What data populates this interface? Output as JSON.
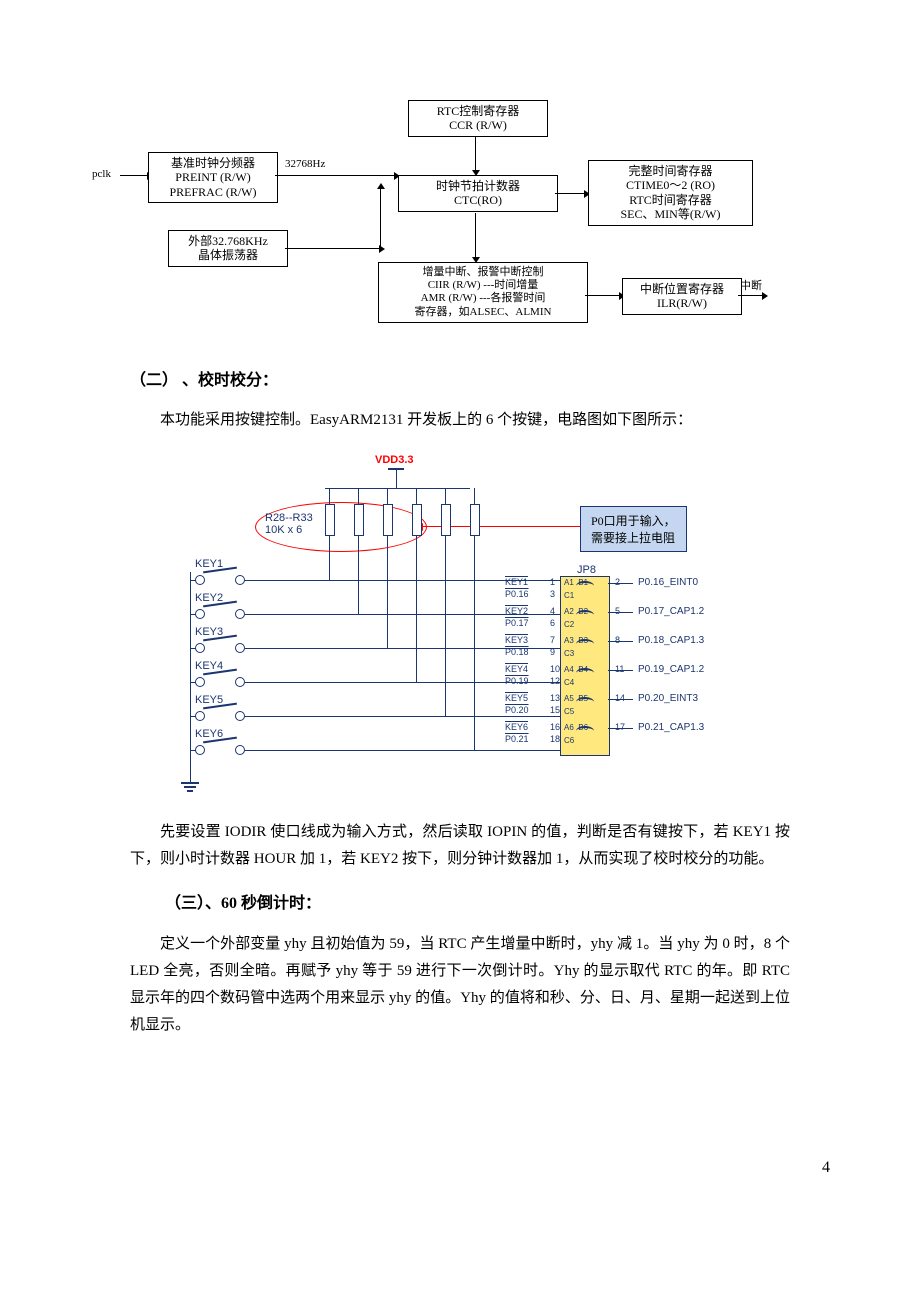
{
  "diagram1": {
    "pclk": "pclk",
    "box1": "基准时钟分频器\nPREINT (R/W)\nPREFRAC (R/W)",
    "freq": "32768Hz",
    "box2": "RTC控制寄存器\nCCR (R/W)",
    "box3": "时钟节拍计数器\nCTC(RO)",
    "box4": "完整时间寄存器\nCTIME0～2 (RO)\nRTC时间寄存器\nSEC、MIN等(R/W)",
    "box5": "外部32.768KHz\n晶体振荡器",
    "box6": "增量中断、报警中断控制\nCIIR (R/W) ---时间增量\nAMR (R/W) ---各报警时间\n寄存器，如ALSEC、ALMIN",
    "box7": "中断位置寄存器\nILR(R/W)",
    "int_out": "中断"
  },
  "section2": {
    "title": "（二） 、校时校分：",
    "para": "本功能采用按键控制。EasyARM2131 开发板上的 6 个按键，电路图如下图所示："
  },
  "diagram2": {
    "vdd": "VDD3.3",
    "res_label": "R28--R33\n10K x 6",
    "callout": "P0口用于输入，\n需要接上拉电阻",
    "keys": [
      "KEY1",
      "KEY2",
      "KEY3",
      "KEY4",
      "KEY5",
      "KEY6"
    ],
    "jp8": "JP8",
    "jp_rows": [
      {
        "kl": "KEY1",
        "l": "1",
        "r": "2",
        "sig": "A1  B1",
        "c": "",
        "port": "P0.16_EINT0",
        "p": "P0.16",
        "pl": "3",
        "cc": "C1"
      },
      {
        "kl": "KEY2",
        "l": "4",
        "r": "5",
        "sig": "A2  B2",
        "c": "",
        "port": "P0.17_CAP1.2",
        "p": "P0.17",
        "pl": "6",
        "cc": "C2"
      },
      {
        "kl": "KEY3",
        "l": "7",
        "r": "8",
        "sig": "A3  B3",
        "c": "",
        "port": "P0.18_CAP1.3",
        "p": "P0.18",
        "pl": "9",
        "cc": "C3"
      },
      {
        "kl": "KEY4",
        "l": "10",
        "r": "11",
        "sig": "A4  B4",
        "c": "",
        "port": "P0.19_CAP1.2",
        "p": "P0.19",
        "pl": "12",
        "cc": "C4"
      },
      {
        "kl": "KEY5",
        "l": "13",
        "r": "14",
        "sig": "A5  B5",
        "c": "",
        "port": "P0.20_EINT3",
        "p": "P0.20",
        "pl": "15",
        "cc": "C5"
      },
      {
        "kl": "KEY6",
        "l": "16",
        "r": "17",
        "sig": "A6  B6",
        "c": "",
        "port": "P0.21_CAP1.3",
        "p": "P0.21",
        "pl": "18",
        "cc": "C6"
      }
    ]
  },
  "section2b": {
    "para": "先要设置 IODIR 使口线成为输入方式，然后读取 IOPIN 的值，判断是否有键按下，若 KEY1 按下，则小时计数器 HOUR 加 1，若 KEY2 按下，则分钟计数器加 1，从而实现了校时校分的功能。"
  },
  "section3": {
    "title": "（三）、60 秒倒计时：",
    "para": "定义一个外部变量 yhy 且初始值为 59，当 RTC 产生增量中断时，yhy 减 1。当 yhy 为 0 时，8 个 LED 全亮，否则全暗。再赋予 yhy 等于 59 进行下一次倒计时。Yhy 的显示取代 RTC 的年。即 RTC 显示年的四个数码管中选两个用来显示 yhy 的值。Yhy 的值将和秒、分、日、月、星期一起送到上位机显示。"
  },
  "page_number": "4"
}
